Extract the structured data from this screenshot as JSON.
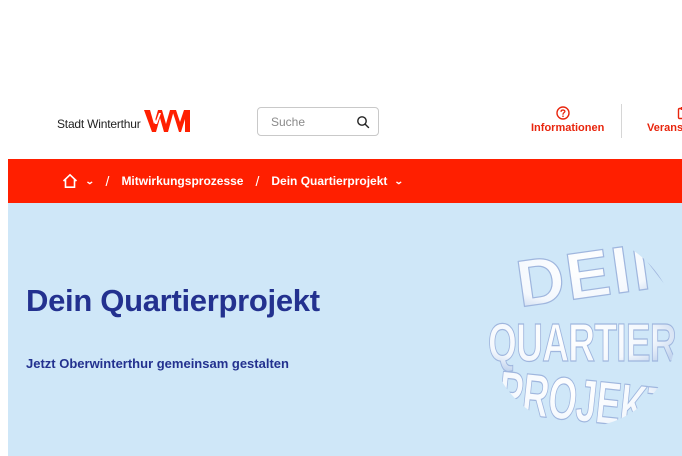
{
  "header": {
    "brand_text": "Stadt Winterthur",
    "search_placeholder": "Suche",
    "nav": [
      {
        "label": "Informationen",
        "icon": "help-circle-icon"
      },
      {
        "label": "Veranst",
        "icon": "calendar-icon"
      }
    ]
  },
  "breadcrumb": {
    "items": [
      "Mitwirkungsprozesse",
      "Dein Quartierprojekt"
    ]
  },
  "hero": {
    "title": "Dein Quartierprojekt",
    "subtitle": "Jetzt Oberwinterthur gemeinsam gestalten",
    "graphic_words": [
      "DEIN",
      "QUARTIER",
      "PROJEKT"
    ]
  },
  "colors": {
    "accent": "#ff1f00",
    "hero_bg": "#cfe7f8",
    "hero_text": "#23318f"
  }
}
